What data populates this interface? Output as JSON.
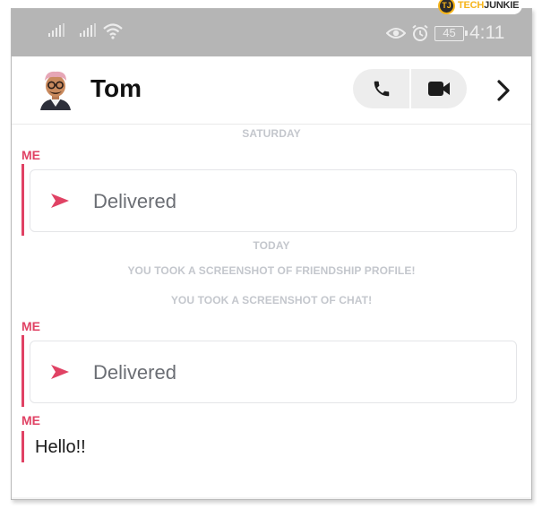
{
  "watermark": {
    "brand_a": "TECH",
    "brand_b": "JUNKIE",
    "logo": "TJ"
  },
  "status_bar": {
    "battery": "45",
    "time": "4:11",
    "icons": [
      "signal-icon",
      "signal-icon",
      "wifi-icon",
      "eye-icon",
      "alarm-icon",
      "battery-icon"
    ]
  },
  "header": {
    "contact_name": "Tom",
    "icons": [
      "avatar-bitmoji",
      "phone-icon",
      "video-camera-icon",
      "chevron-right-icon"
    ]
  },
  "chat": {
    "day1": "SATURDAY",
    "msg1": {
      "sender": "ME",
      "status": "Delivered"
    },
    "day2": "TODAY",
    "notice1": "YOU TOOK A SCREENSHOT OF FRIENDSHIP PROFILE!",
    "notice2": "YOU TOOK A SCREENSHOT OF CHAT!",
    "msg2": {
      "sender": "ME",
      "status": "Delivered"
    },
    "msg3": {
      "sender": "ME",
      "text": "Hello!!"
    }
  },
  "colors": {
    "accent": "#e04264",
    "status_bar": "#b5b5b5",
    "meta_text": "#c4c7cd"
  }
}
